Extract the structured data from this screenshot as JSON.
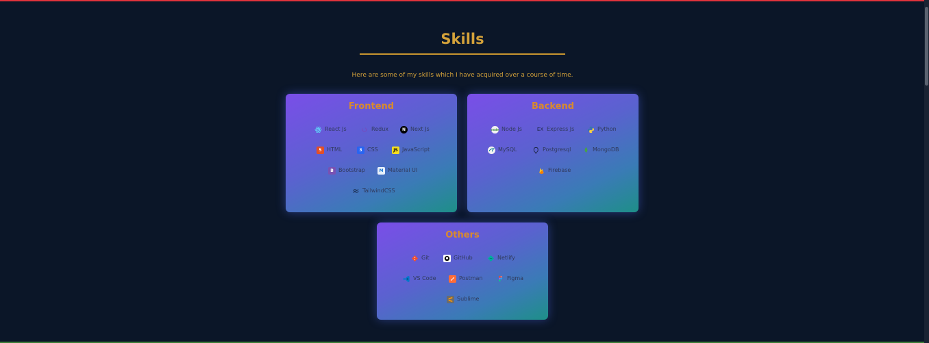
{
  "heading": "Skills",
  "subtitle": "Here are some of my skills which I have acquired over a course of time.",
  "cards": {
    "frontend": {
      "title": "Frontend",
      "skills": [
        "React Js",
        "Redux",
        "Next Js",
        "HTML",
        "CSS",
        "JavaScript",
        "Bootstrap",
        "Material UI",
        "TailwindCSS"
      ]
    },
    "backend": {
      "title": "Backend",
      "skills": [
        "Node Js",
        "Express Js",
        "Python",
        "MySQL",
        "Postgresql",
        "MongoDB",
        "Firebase"
      ]
    },
    "others": {
      "title": "Others",
      "skills": [
        "Git",
        "GitHub",
        "Netlify",
        "VS Code",
        "Postman",
        "Figma",
        "Sublime"
      ]
    }
  },
  "icon_glyphs": {
    "html": "5",
    "css": "3",
    "javascript": "JS",
    "bootstrap": "B",
    "express": "EX",
    "nextjs": "N",
    "mui": "M",
    "node": "node"
  },
  "colors": {
    "background": "#0b1628",
    "accent": "#d4a23a",
    "card_title": "#d98a2e",
    "top_bar": "#e0323c",
    "bottom_bar": "#3d7d3a"
  }
}
